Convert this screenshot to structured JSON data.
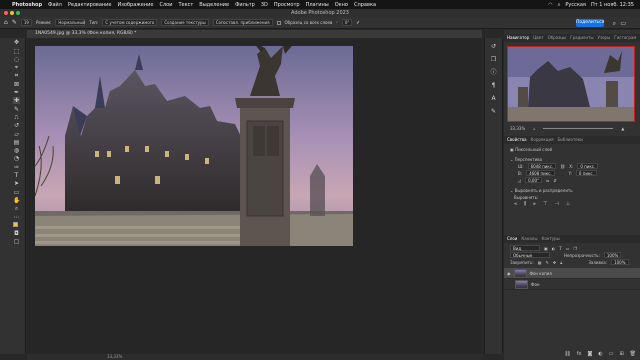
{
  "macos_menu": {
    "items": [
      "Photoshop",
      "Файл",
      "Редактирование",
      "Изображение",
      "Слои",
      "Текст",
      "Выделение",
      "Фильтр",
      "3D",
      "Просмотр",
      "Плагины",
      "Окно",
      "Справка"
    ],
    "right": {
      "lang": "Русская",
      "time": "Пт 1 нояб. 12:35"
    }
  },
  "window": {
    "title": "Adobe Photoshop 2023"
  },
  "options": {
    "brush_size": "19",
    "mode_label": "Режим:",
    "mode_value": "Нормальный",
    "type_label": "Тип:",
    "type_btn1": "С учетом содержимого",
    "type_btn2": "Создание текстуры",
    "type_btn3": "Сопоставл. приближения",
    "sample_label": "Образец со всех слоев",
    "angle_value": "0°",
    "share": "Поделиться"
  },
  "document": {
    "tab": "1NA0549.jpg @ 33,3% (Фон копия, RGB/8) *",
    "status": "33,33%"
  },
  "navigator": {
    "tabs": [
      "Навигатор",
      "Цвет",
      "Образцы",
      "Градиенты",
      "Узоры",
      "Гистограм"
    ],
    "zoom": "33,33%"
  },
  "properties": {
    "tabs": [
      "Свойства",
      "Коррекция",
      "Библиотеки"
    ],
    "layer_type": "Пиксельный слой",
    "transform_header": "Перспектива",
    "w_label": "Ш:",
    "w_value": "6048 пикс.",
    "h_label": "В:",
    "h_value": "4608 пикс.",
    "x_label": "X:",
    "x_value": "0 пикс.",
    "y_label": "Y:",
    "y_value": "0 пикс.",
    "angle": "0,00°",
    "align_header": "Выровнять и распределить",
    "align_label": "Выровнять:"
  },
  "layers": {
    "tabs": [
      "Слои",
      "Каналы",
      "Контуры"
    ],
    "filter_label": "Вид",
    "blend_mode": "Обычные",
    "opacity_label": "Непрозрачность:",
    "opacity_value": "100%",
    "lock_label": "Закрепить:",
    "fill_label": "Заливка:",
    "fill_value": "100%",
    "items": [
      {
        "name": "Фон копия",
        "visible": true,
        "selected": true
      },
      {
        "name": "Фон",
        "visible": false,
        "selected": false
      }
    ]
  },
  "icons": {
    "apple": "apple-icon",
    "home": "home-icon",
    "brush": "healing-brush-icon"
  }
}
